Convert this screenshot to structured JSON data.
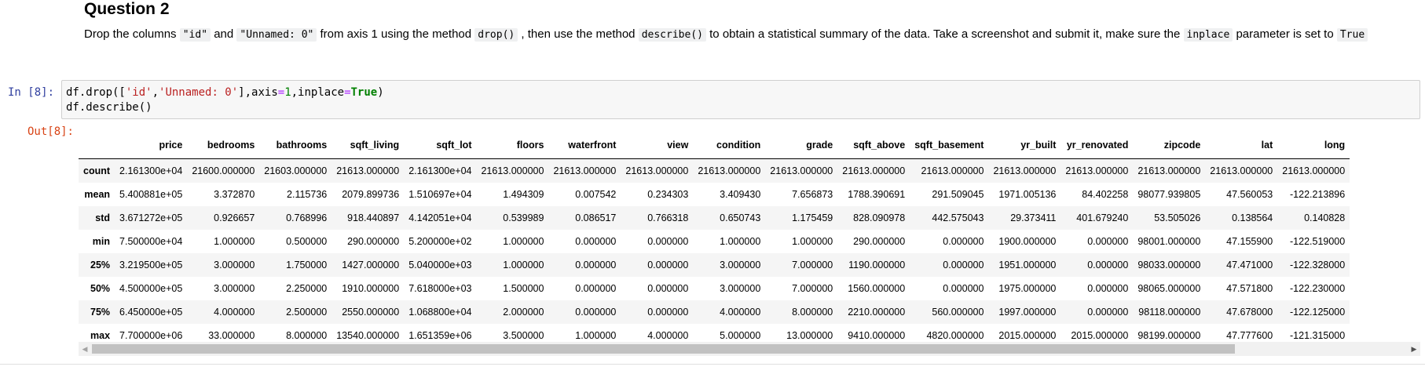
{
  "markdown": {
    "title": "Question 2",
    "p1": "Drop the columns ",
    "c1": "\"id\"",
    "p2": " and ",
    "c2": "\"Unnamed: 0\"",
    "p3": " from axis 1 using the method ",
    "c3": "drop()",
    "p4": " , then use the method ",
    "c4": "describe()",
    "p5": " to obtain a statistical summary of the data. Take a screenshot and submit it, make sure the ",
    "c5": "inplace",
    "p6": " parameter is set to ",
    "c6": "True"
  },
  "cell": {
    "in_prompt": "In [8]:",
    "out_prompt": "Out[8]:",
    "code_line1": {
      "a": "df.drop([",
      "s1": "'id'",
      "b": ",",
      "s2": "'Unnamed: 0'",
      "c": "],axis",
      "eq1": "=",
      "n1": "1",
      "d": ",inplace",
      "eq2": "=",
      "kw": "True",
      "e": ")"
    },
    "code_line2": "df.describe()"
  },
  "table": {
    "columns": [
      "",
      "price",
      "bedrooms",
      "bathrooms",
      "sqft_living",
      "sqft_lot",
      "floors",
      "waterfront",
      "view",
      "condition",
      "grade",
      "sqft_above",
      "sqft_basement",
      "yr_built",
      "yr_renovated",
      "zipcode",
      "lat",
      "long"
    ],
    "rows": [
      [
        "count",
        "2.161300e+04",
        "21600.000000",
        "21603.000000",
        "21613.000000",
        "2.161300e+04",
        "21613.000000",
        "21613.000000",
        "21613.000000",
        "21613.000000",
        "21613.000000",
        "21613.000000",
        "21613.000000",
        "21613.000000",
        "21613.000000",
        "21613.000000",
        "21613.000000",
        "21613.000000"
      ],
      [
        "mean",
        "5.400881e+05",
        "3.372870",
        "2.115736",
        "2079.899736",
        "1.510697e+04",
        "1.494309",
        "0.007542",
        "0.234303",
        "3.409430",
        "7.656873",
        "1788.390691",
        "291.509045",
        "1971.005136",
        "84.402258",
        "98077.939805",
        "47.560053",
        "-122.213896"
      ],
      [
        "std",
        "3.671272e+05",
        "0.926657",
        "0.768996",
        "918.440897",
        "4.142051e+04",
        "0.539989",
        "0.086517",
        "0.766318",
        "0.650743",
        "1.175459",
        "828.090978",
        "442.575043",
        "29.373411",
        "401.679240",
        "53.505026",
        "0.138564",
        "0.140828"
      ],
      [
        "min",
        "7.500000e+04",
        "1.000000",
        "0.500000",
        "290.000000",
        "5.200000e+02",
        "1.000000",
        "0.000000",
        "0.000000",
        "1.000000",
        "1.000000",
        "290.000000",
        "0.000000",
        "1900.000000",
        "0.000000",
        "98001.000000",
        "47.155900",
        "-122.519000"
      ],
      [
        "25%",
        "3.219500e+05",
        "3.000000",
        "1.750000",
        "1427.000000",
        "5.040000e+03",
        "1.000000",
        "0.000000",
        "0.000000",
        "3.000000",
        "7.000000",
        "1190.000000",
        "0.000000",
        "1951.000000",
        "0.000000",
        "98033.000000",
        "47.471000",
        "-122.328000"
      ],
      [
        "50%",
        "4.500000e+05",
        "3.000000",
        "2.250000",
        "1910.000000",
        "7.618000e+03",
        "1.500000",
        "0.000000",
        "0.000000",
        "3.000000",
        "7.000000",
        "1560.000000",
        "0.000000",
        "1975.000000",
        "0.000000",
        "98065.000000",
        "47.571800",
        "-122.230000"
      ],
      [
        "75%",
        "6.450000e+05",
        "4.000000",
        "2.500000",
        "2550.000000",
        "1.068800e+04",
        "2.000000",
        "0.000000",
        "0.000000",
        "4.000000",
        "8.000000",
        "2210.000000",
        "560.000000",
        "1997.000000",
        "0.000000",
        "98118.000000",
        "47.678000",
        "-122.125000"
      ],
      [
        "max",
        "7.700000e+06",
        "33.000000",
        "8.000000",
        "13540.000000",
        "1.651359e+06",
        "3.500000",
        "1.000000",
        "4.000000",
        "5.000000",
        "13.000000",
        "9410.000000",
        "4820.000000",
        "2015.000000",
        "2015.000000",
        "98199.000000",
        "47.777600",
        "-121.315000"
      ]
    ]
  },
  "scrollbar": {
    "left_arrow": "◀",
    "right_arrow": "▶"
  }
}
